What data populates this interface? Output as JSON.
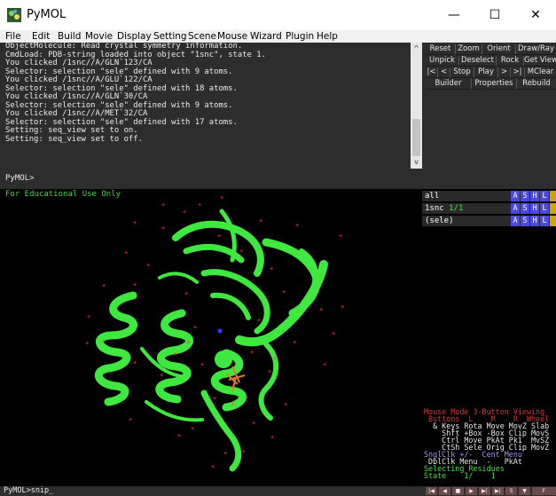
{
  "window": {
    "title": "PyMOL",
    "minimize": "—",
    "maximize": "☐",
    "close": "✕"
  },
  "menu": [
    "File",
    "Edit",
    "Build",
    "Movie",
    "Display",
    "Setting",
    "Scene",
    "Mouse",
    "Wizard",
    "Plugin",
    "Help"
  ],
  "console_lines": [
    "ObjectMolecule: Read crystal symmetry information.",
    "CmdLoad: PDB-string loaded into object \"1snc\", state 1.",
    "You clicked /1snc//A/GLN`123/CA",
    "Selector: selection \"sele\" defined with 9 atoms.",
    "You clicked /1snc//A/GLU`122/CA",
    "Selector: selection \"sele\" defined with 18 atoms.",
    "You clicked /1snc//A/GLN`30/CA",
    "Selector: selection \"sele\" defined with 9 atoms.",
    "You clicked /1snc//A/MET`32/CA",
    "Selector: selection \"sele\" defined with 17 atoms.",
    "Setting: seq_view set to on.",
    "Setting: seq_view set to off."
  ],
  "control_buttons": {
    "row1": [
      "Reset",
      "Zoom",
      "Orient",
      "Draw/Ray"
    ],
    "row2": [
      "Unpick",
      "Deselect",
      "Rock",
      "Get View"
    ],
    "row3": [
      "|<",
      "<",
      "Stop",
      "Play",
      ">",
      ">|",
      "MClear"
    ],
    "row4": [
      "Builder",
      "Properties",
      "Rebuild"
    ]
  },
  "prompt": "PyMOL>",
  "viewer": {
    "edu_label": "For Educational Use Only"
  },
  "objects": [
    {
      "name": "all",
      "state": ""
    },
    {
      "name": "1snc",
      "state": "1/1"
    },
    {
      "name": "(sele)",
      "state": ""
    }
  ],
  "object_buttons": [
    "A",
    "S",
    "H",
    "L"
  ],
  "mouse_panel": {
    "line1": "Mouse Mode 3-Button Viewing",
    "line2": " Buttons  L    M    R  Wheel",
    "line3": "  & Keys Rota Move MovZ Slab",
    "line4": "    Shft +Box -Box Clip MovS",
    "line5": "    Ctrl Move PkAt Pk1  MvSZ",
    "line6": "    CtSh Sele Orig Clip MovZ",
    "line7": "SnglClk +/-  Cent Menu",
    "line8": " DblClk Menu  -   PkAt",
    "line9": "Selecting Residues",
    "line10": "State    1/    1"
  },
  "command_line": "PyMOL>snip_",
  "colors": {
    "protein": "#3ee83e",
    "water": "#ff3a3a",
    "ligand": "#e07a2a",
    "nitrogen": "#3a3aff"
  }
}
